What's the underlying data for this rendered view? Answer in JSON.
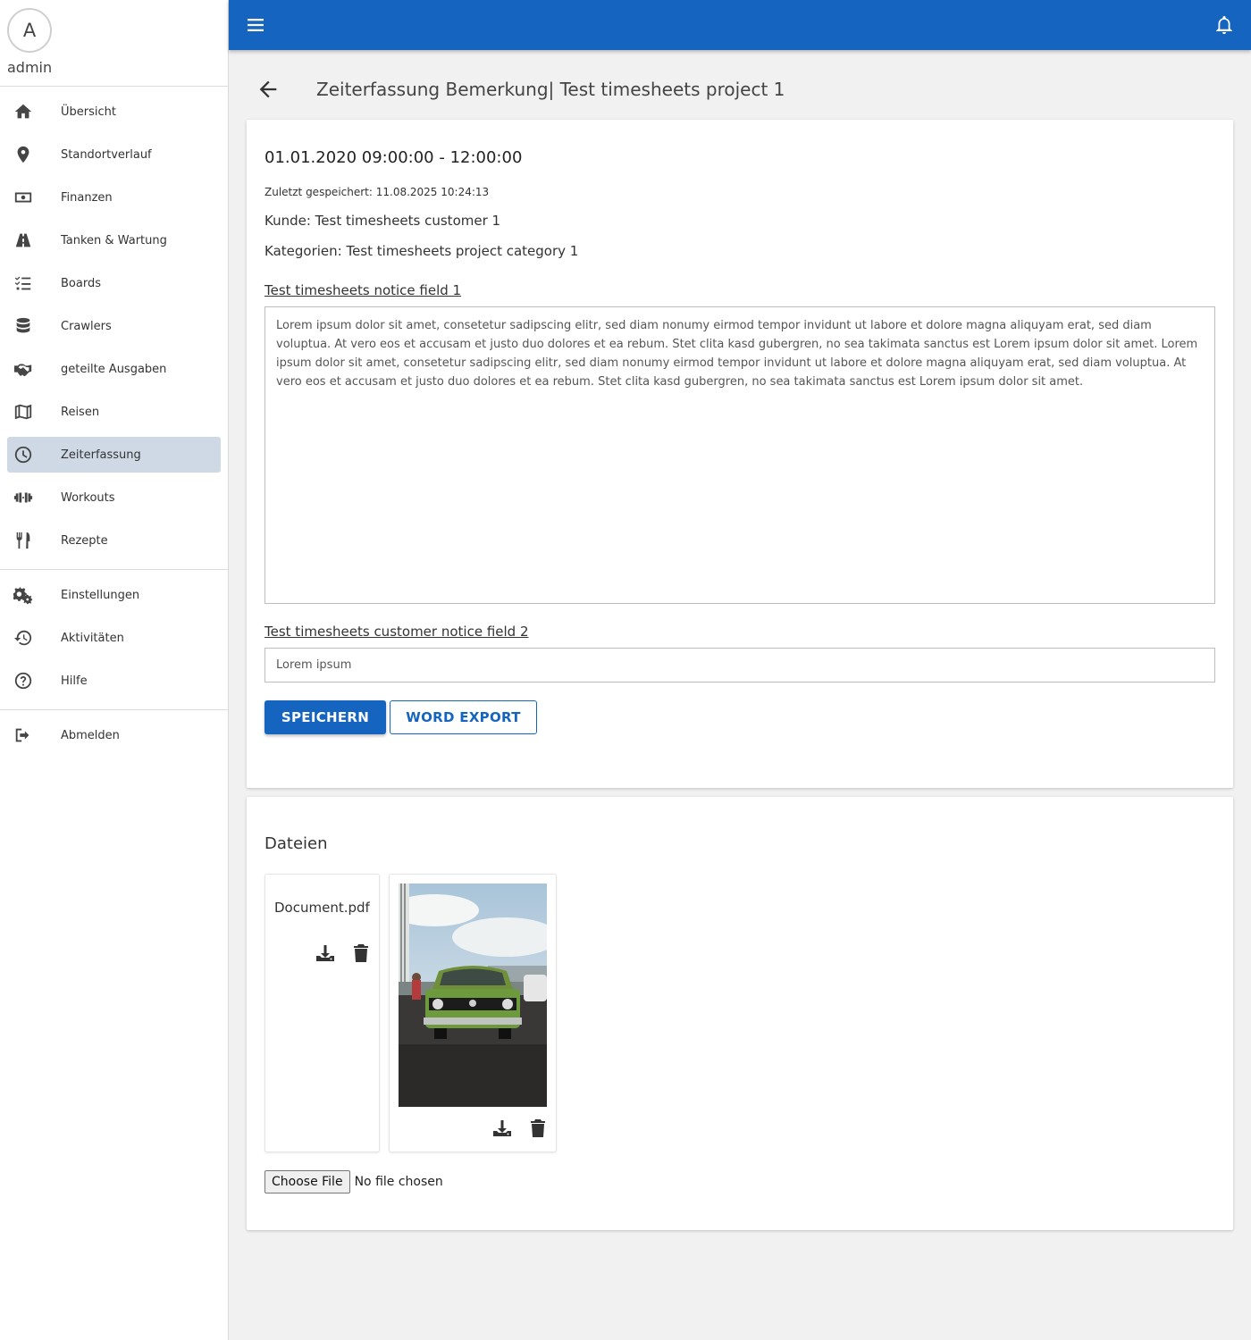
{
  "user": {
    "avatar_letter": "A",
    "name": "admin"
  },
  "sidebar": {
    "items": [
      {
        "label": "Übersicht",
        "icon": "home-icon"
      },
      {
        "label": "Standortverlauf",
        "icon": "location-pin-icon"
      },
      {
        "label": "Finanzen",
        "icon": "money-icon"
      },
      {
        "label": "Tanken & Wartung",
        "icon": "road-icon"
      },
      {
        "label": "Boards",
        "icon": "tasks-icon"
      },
      {
        "label": "Crawlers",
        "icon": "database-icon"
      },
      {
        "label": "geteilte Ausgaben",
        "icon": "handshake-icon"
      },
      {
        "label": "Reisen",
        "icon": "map-icon"
      },
      {
        "label": "Zeiterfassung",
        "icon": "clock-icon",
        "active": true
      },
      {
        "label": "Workouts",
        "icon": "dumbbell-icon"
      },
      {
        "label": "Rezepte",
        "icon": "utensils-icon"
      }
    ],
    "settings_items": [
      {
        "label": "Einstellungen",
        "icon": "gears-icon"
      },
      {
        "label": "Aktivitäten",
        "icon": "history-icon"
      },
      {
        "label": "Hilfe",
        "icon": "question-circle-icon"
      }
    ],
    "logout": {
      "label": "Abmelden",
      "icon": "sign-out-icon"
    }
  },
  "header": {
    "title": "Zeiterfassung Bemerkung| Test timesheets project 1"
  },
  "entry": {
    "time_range": "01.01.2020 09:00:00 - 12:00:00",
    "saved_at": "Zuletzt gespeichert: 11.08.2025 10:24:13",
    "customer": "Kunde: Test timesheets customer 1",
    "categories": "Kategorien: Test timesheets project category 1",
    "field1_label": "Test timesheets notice field 1",
    "field1_value": "Lorem ipsum dolor sit amet, consetetur sadipscing elitr, sed diam nonumy eirmod tempor invidunt ut labore et dolore magna aliquyam erat, sed diam voluptua. At vero eos et accusam et justo duo dolores et ea rebum. Stet clita kasd gubergren, no sea takimata sanctus est Lorem ipsum dolor sit amet. Lorem ipsum dolor sit amet, consetetur sadipscing elitr, sed diam nonumy eirmod tempor invidunt ut labore et dolore magna aliquyam erat, sed diam voluptua. At vero eos et accusam et justo duo dolores et ea rebum. Stet clita kasd gubergren, no sea takimata sanctus est Lorem ipsum dolor sit amet.",
    "field2_label": "Test timesheets customer notice field 2",
    "field2_value": "Lorem ipsum",
    "save_label": "SPEICHERN",
    "export_label": "WORD EXPORT"
  },
  "files": {
    "title": "Dateien",
    "items": [
      {
        "name": "Document.pdf",
        "type": "pdf"
      },
      {
        "name": "",
        "type": "image"
      }
    ],
    "choose_label": "Choose File",
    "no_file_label": "No file chosen"
  },
  "colors": {
    "primary": "#1565c0",
    "active_nav": "#cfd9e5"
  }
}
